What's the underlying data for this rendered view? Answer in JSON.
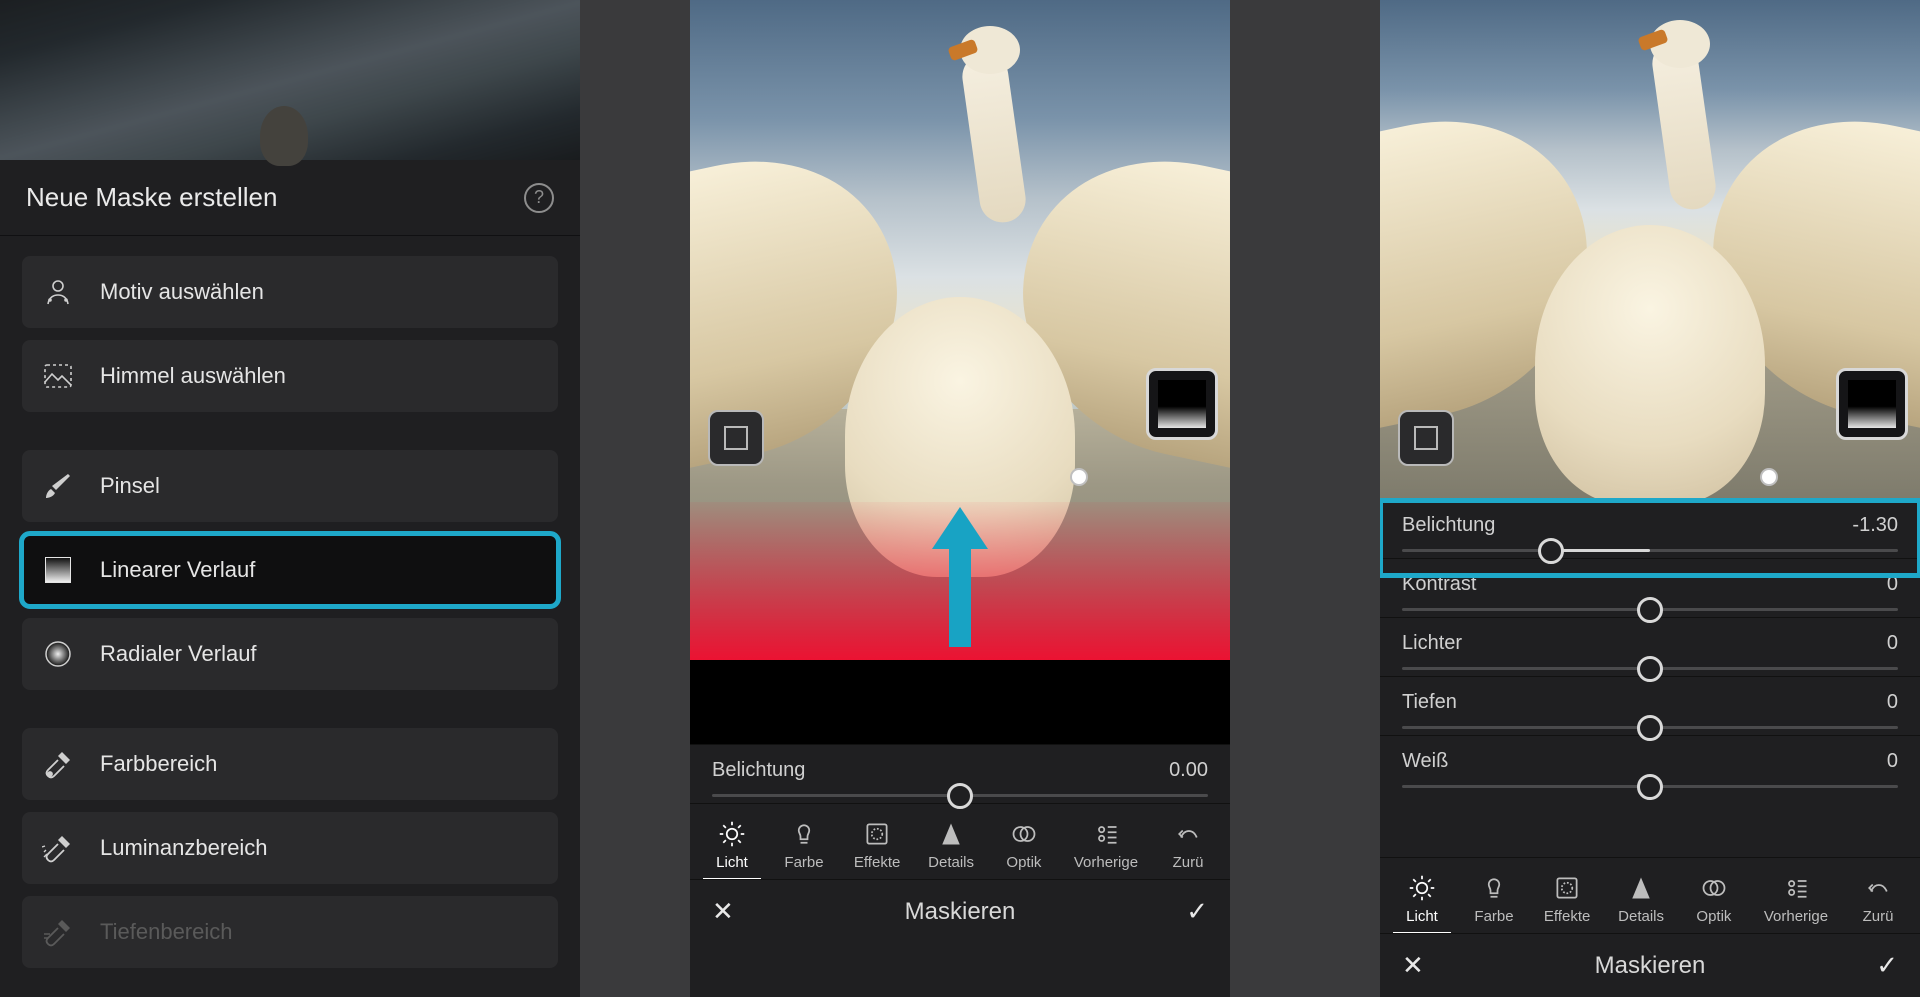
{
  "left": {
    "title": "Neue Maske erstellen",
    "items": [
      {
        "id": "subject",
        "label": "Motiv auswählen"
      },
      {
        "id": "sky",
        "label": "Himmel auswählen"
      },
      {
        "id": "brush",
        "label": "Pinsel"
      },
      {
        "id": "linear",
        "label": "Linearer Verlauf",
        "selected": true
      },
      {
        "id": "radial",
        "label": "Radialer Verlauf"
      },
      {
        "id": "color",
        "label": "Farbbereich"
      },
      {
        "id": "luminance",
        "label": "Luminanzbereich"
      },
      {
        "id": "depth",
        "label": "Tiefenbereich",
        "disabled": true
      }
    ]
  },
  "middle": {
    "slider": {
      "label": "Belichtung",
      "value": "0.00",
      "pos": 50
    },
    "tabs": [
      "Licht",
      "Farbe",
      "Effekte",
      "Details",
      "Optik",
      "Vorherige",
      "Zurü"
    ],
    "activeTab": 0,
    "bottom": "Maskieren"
  },
  "right": {
    "sliders": [
      {
        "label": "Belichtung",
        "value": "-1.30",
        "pos": 30,
        "fill_from": 30,
        "fill_to": 50
      },
      {
        "label": "Kontrast",
        "value": "0",
        "pos": 50
      },
      {
        "label": "Lichter",
        "value": "0",
        "pos": 50
      },
      {
        "label": "Tiefen",
        "value": "0",
        "pos": 50
      },
      {
        "label": "Weiß",
        "value": "0",
        "pos": 50
      }
    ],
    "tabs": [
      "Licht",
      "Farbe",
      "Effekte",
      "Details",
      "Optik",
      "Vorherige",
      "Zurü"
    ],
    "activeTab": 0,
    "bottom": "Maskieren"
  }
}
